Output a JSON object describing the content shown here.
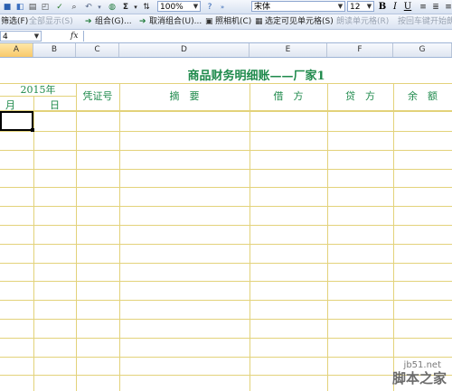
{
  "toolbar1": {
    "zoom": "100%",
    "font_name": "宋体",
    "font_size": "12",
    "bold": "B",
    "italic": "I",
    "underline": "U"
  },
  "toolbar2": {
    "filter": "筛选(F)",
    "show_all": "全部显示(S)",
    "group": "组合(G)...",
    "ungroup": "取消组合(U)...",
    "camera": "照相机(C)",
    "select_visible": "选定可见单元格(S)",
    "prev_cell": "朗读单元格(R)",
    "by_row": "按回车键开始朗读"
  },
  "formula_bar": {
    "name_box": "4",
    "fx": "fx"
  },
  "columns": [
    "A",
    "B",
    "C",
    "D",
    "E",
    "F",
    "G"
  ],
  "sheet": {
    "title": "商品财务明细账——厂家1",
    "year": "2015年",
    "month": "月",
    "day": "日",
    "voucher": "凭证号",
    "summary": "摘　要",
    "debit": "借　方",
    "credit": "贷　方",
    "balance": "余　额"
  },
  "watermark": {
    "site": "jb51.net",
    "name": "脚本之家"
  }
}
